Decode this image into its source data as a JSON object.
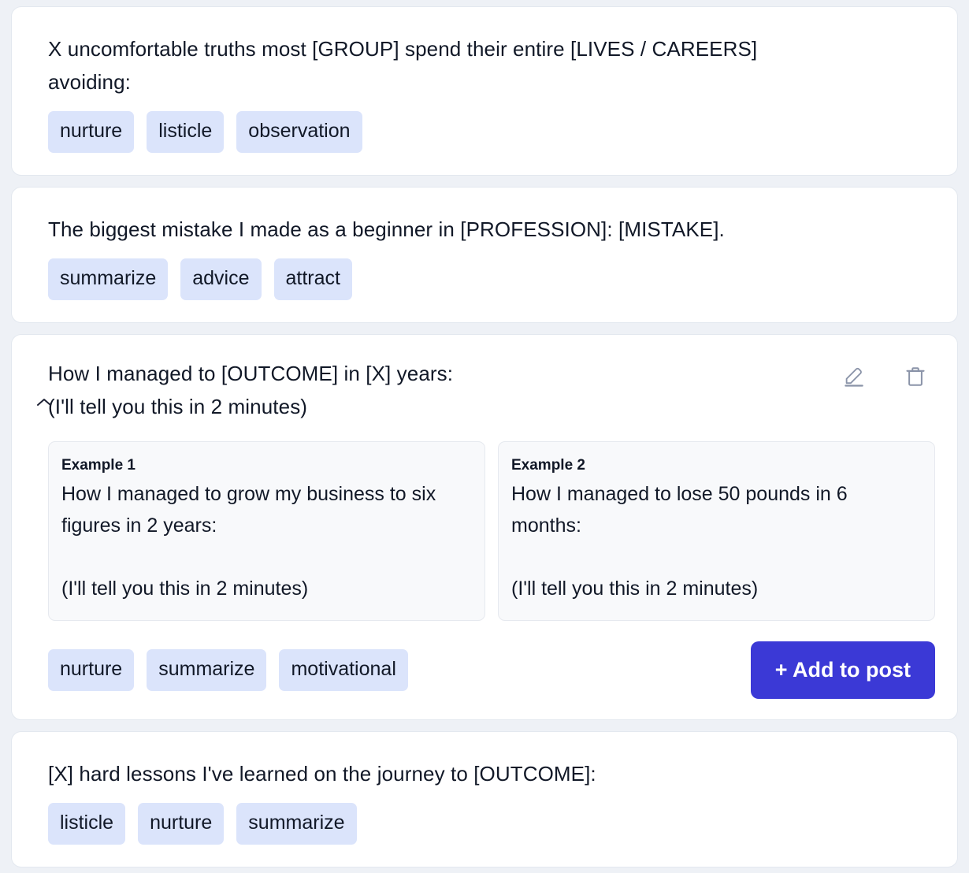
{
  "theme": {
    "page_background": "#eef1f6",
    "card_background": "#ffffff",
    "card_border": "#e3e8ef",
    "tag_background": "#dbe4fb",
    "tag_text": "#111827",
    "example_background": "#f8f9fb",
    "example_border": "#e6e9ef",
    "accent_button": "#3b39d6",
    "icon_color": "#8a93a8"
  },
  "cards": [
    {
      "id": "card-1",
      "expanded": false,
      "prompt": "X uncomfortable truths most [GROUP] spend their entire [LIVES / CAREERS] avoiding:",
      "tags": [
        "nurture",
        "listicle",
        "observation"
      ]
    },
    {
      "id": "card-2",
      "expanded": false,
      "prompt": "The biggest mistake I made as a beginner in [PROFESSION]: [MISTAKE].",
      "tags": [
        "summarize",
        "advice",
        "attract"
      ]
    },
    {
      "id": "card-3",
      "expanded": true,
      "prompt": "How I managed to [OUTCOME] in [X] years:\n(I'll tell you this in 2 minutes)",
      "collapse_icon": "chevron-up-icon",
      "edit_icon": "pencil-edit-icon",
      "delete_icon": "trash-delete-icon",
      "examples": [
        {
          "label": "Example 1",
          "text": "How I managed to grow my business to six figures in 2 years:\n\n(I'll tell you this in 2 minutes)"
        },
        {
          "label": "Example 2",
          "text": "How I managed to lose 50 pounds in 6 months:\n\n(I'll tell you this in 2 minutes)"
        }
      ],
      "tags": [
        "nurture",
        "summarize",
        "motivational"
      ],
      "add_button_label": "+ Add to post"
    },
    {
      "id": "card-4",
      "expanded": false,
      "prompt": "[X] hard lessons I've learned on the journey to [OUTCOME]:",
      "tags": [
        "listicle",
        "nurture",
        "summarize"
      ]
    }
  ]
}
